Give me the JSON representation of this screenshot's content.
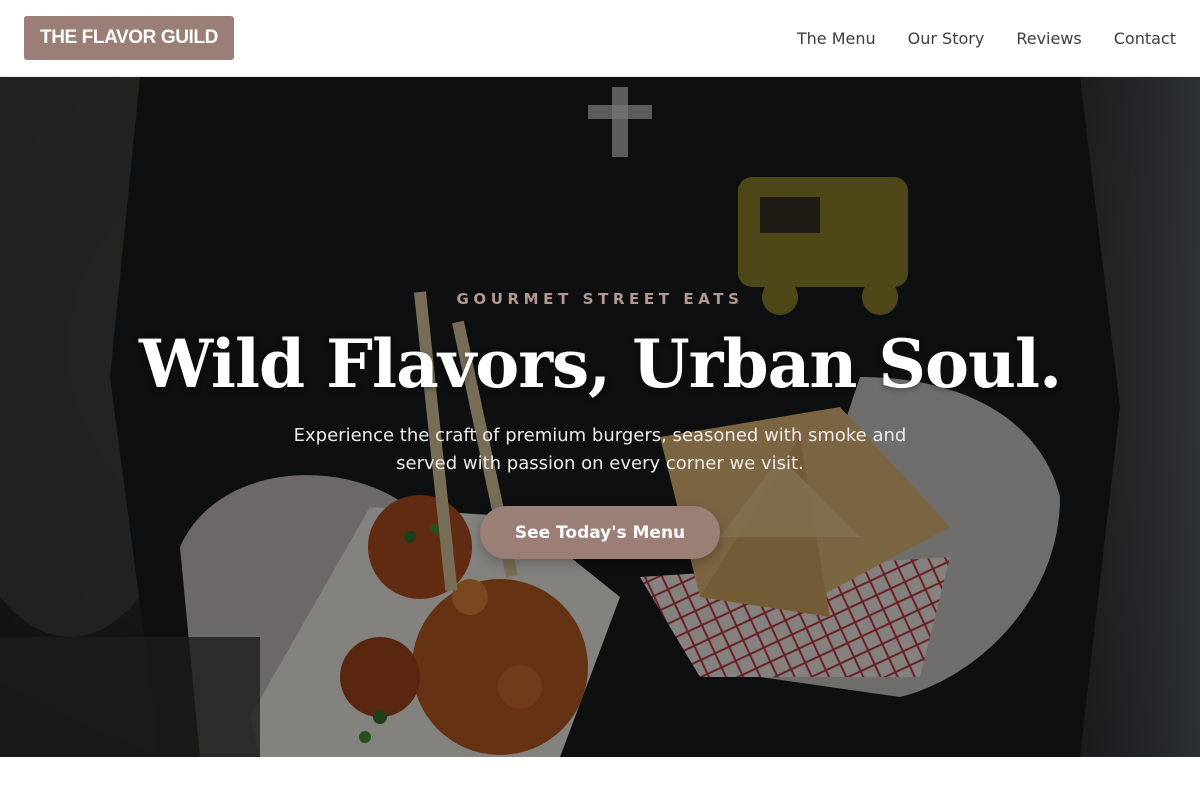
{
  "header": {
    "logo_text": "THE FLAVOR GUILD",
    "nav": [
      "The Menu",
      "Our Story",
      "Reviews",
      "Contact"
    ]
  },
  "hero": {
    "eyebrow": "GOURMET STREET EATS",
    "headline": "Wild Flavors, Urban Soul.",
    "subtitle": "Experience the craft of premium burgers, seasoned with smoke and served with passion on every corner we visit.",
    "cta_label": "See Today's Menu",
    "background_image": "food-vendor-holding-street-food"
  },
  "colors": {
    "accent": "#9b7f76",
    "eyebrow": "#b59990",
    "header_bg": "#ffffff",
    "hero_overlay": "#0a0a0c"
  }
}
